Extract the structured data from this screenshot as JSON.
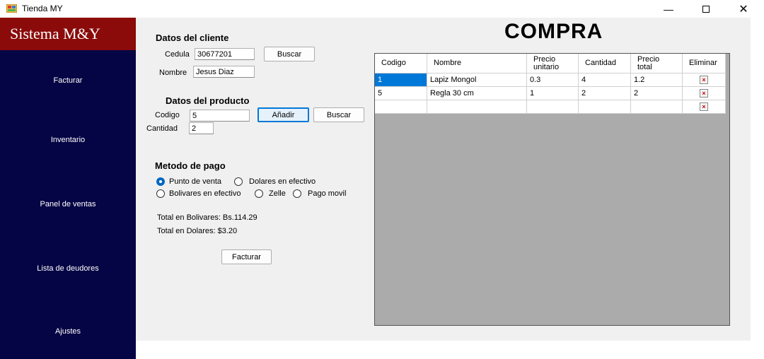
{
  "window": {
    "title": "Tienda MY",
    "minimize_icon": "minimize-icon",
    "maximize_icon": "maximize-icon",
    "close_icon": "close-icon"
  },
  "sidebar": {
    "brand": "Sistema M&Y",
    "items": [
      {
        "label": "Facturar"
      },
      {
        "label": "Inventario"
      },
      {
        "label": "Panel de ventas"
      },
      {
        "label": "Lista de deudores"
      },
      {
        "label": "Ajustes"
      }
    ],
    "colors": {
      "background": "#050545",
      "brand_background": "#8b0a0a"
    }
  },
  "cliente": {
    "section_title": "Datos del cliente",
    "cedula_label": "Cedula",
    "cedula_value": "30677201",
    "buscar_label": "Buscar",
    "nombre_label": "Nombre",
    "nombre_value": "Jesus Diaz"
  },
  "producto": {
    "section_title": "Datos del producto",
    "codigo_label": "Codigo",
    "codigo_value": "5",
    "anadir_label": "Añadir",
    "buscar_label": "Buscar",
    "cantidad_label": "Cantidad",
    "cantidad_value": "2"
  },
  "pago": {
    "section_title": "Metodo de pago",
    "options": [
      {
        "label": "Punto de venta",
        "checked": true
      },
      {
        "label": "Dolares en efectivo",
        "checked": false
      },
      {
        "label": "Bolivares en efectivo",
        "checked": false
      },
      {
        "label": "Zelle",
        "checked": false
      },
      {
        "label": "Pago movil",
        "checked": false
      }
    ]
  },
  "totales": {
    "bolivares": "Total en Bolivares: Bs.114.29",
    "dolares": "Total en Dolares: $3.20"
  },
  "facturar_button": "Facturar",
  "compra": {
    "title": "COMPRA",
    "columns": [
      "Codigo",
      "Nombre",
      "Precio\nunitario",
      "Cantidad",
      "Precio\ntotal",
      "Eliminar"
    ],
    "rows": [
      {
        "codigo": "1",
        "nombre": "Lapiz Mongol",
        "precio_unitario": "0.3",
        "cantidad": "4",
        "precio_total": "1.2",
        "eliminar_icon": "delete-icon"
      },
      {
        "codigo": "5",
        "nombre": "Regla 30 cm",
        "precio_unitario": "1",
        "cantidad": "2",
        "precio_total": "2",
        "eliminar_icon": "delete-icon"
      },
      {
        "codigo": "",
        "nombre": "",
        "precio_unitario": "",
        "cantidad": "",
        "precio_total": "",
        "eliminar_icon": "delete-icon"
      }
    ],
    "delete_glyph": "×",
    "selected_color": "#0078d7"
  }
}
